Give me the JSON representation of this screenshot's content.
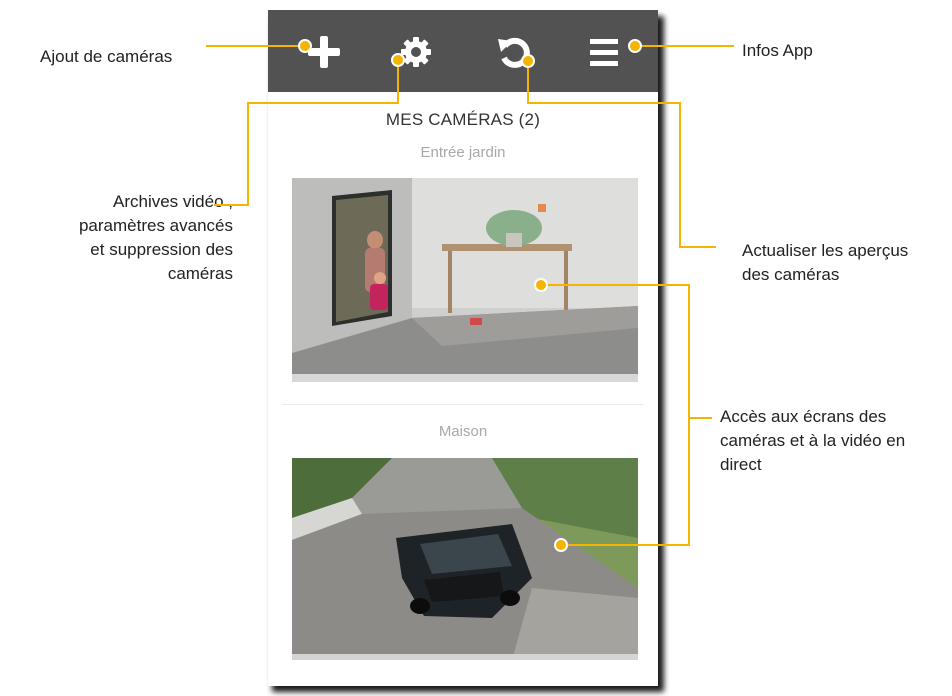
{
  "app": {
    "screen_title": "MES CAMÉRAS (2)",
    "toolbar_icons": [
      "plus-icon",
      "gear-icon",
      "refresh-icon",
      "menu-icon"
    ],
    "cameras": [
      {
        "name": "Entrée jardin"
      },
      {
        "name": "Maison"
      }
    ]
  },
  "annotations": {
    "add_cameras": "Ajout de caméras",
    "archives_1": "Archives vidéo ,",
    "archives_2": "paramètres avancés",
    "archives_3": "et suppression des",
    "archives_4": "caméras",
    "infos": "Infos App",
    "refresh_1": "Actualiser les aperçus",
    "refresh_2": "des caméras",
    "access_1": "Accès aux écrans des",
    "access_2": "caméras et à la vidéo en",
    "access_3": "direct"
  },
  "colors": {
    "toolbar": "#525252",
    "callout": "#f5b400",
    "icon": "#ffffff"
  }
}
